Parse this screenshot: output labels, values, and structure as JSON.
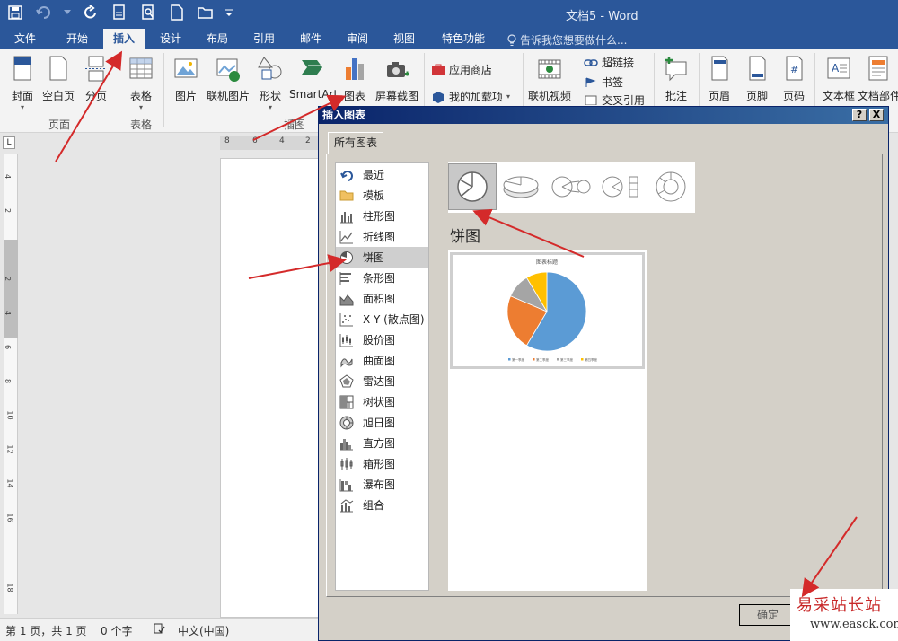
{
  "window": {
    "title": "文档5 - Word"
  },
  "tabs": [
    "文件",
    "开始",
    "插入",
    "设计",
    "布局",
    "引用",
    "邮件",
    "审阅",
    "视图",
    "特色功能"
  ],
  "active_tab": "插入",
  "tell_me": "告诉我您想要做什么...",
  "ribbon": {
    "pages_group": {
      "cover": "封面",
      "blank_page": "空白页",
      "page_break": "分页",
      "label": "页面"
    },
    "tables_group": {
      "table": "表格",
      "label": "表格"
    },
    "illustrations_group": {
      "picture": "图片",
      "online_picture": "联机图片",
      "shapes": "形状",
      "smartart": "SmartArt",
      "chart": "图表",
      "screenshot": "屏幕截图",
      "label": "插图"
    },
    "addins": {
      "store": "应用商店",
      "my_addins": "我的加载项"
    },
    "media": {
      "online_video": "联机视频"
    },
    "links": {
      "hyperlink": "超链接",
      "bookmark": "书签",
      "cross_reference": "交叉引用"
    },
    "comment": "批注",
    "header": "页眉",
    "footer": "页脚",
    "page_number": "页码",
    "text_box": "文本框",
    "doc_parts": "文档部件"
  },
  "ruler": {
    "h_ticks": [
      "8",
      "6",
      "4",
      "2"
    ],
    "v_ticks": [
      "4",
      "2",
      "2",
      "4",
      "6",
      "8",
      "10",
      "12",
      "14",
      "16",
      "18"
    ]
  },
  "statusbar": {
    "page": "第 1 页，共 1 页",
    "words": "0 个字",
    "language": "中文(中国)"
  },
  "dialog": {
    "title": "插入图表",
    "help": "?",
    "close": "X",
    "tab": "所有图表",
    "categories": [
      "最近",
      "模板",
      "柱形图",
      "折线图",
      "饼图",
      "条形图",
      "面积图",
      "X Y (散点图)",
      "股价图",
      "曲面图",
      "雷达图",
      "树状图",
      "旭日图",
      "直方图",
      "箱形图",
      "瀑布图",
      "组合"
    ],
    "selected_category": "饼图",
    "subtypes": [
      "pie",
      "3d-pie",
      "pie-of-pie",
      "bar-of-pie",
      "doughnut"
    ],
    "type_heading": "饼图",
    "ok": "确定"
  },
  "chart_data": {
    "type": "pie",
    "title": "图表标题",
    "categories": [
      "第一季度",
      "第二季度",
      "第三季度",
      "第四季度"
    ],
    "values": [
      8.2,
      3.2,
      1.4,
      1.2
    ],
    "colors": [
      "#5b9bd5",
      "#ed7d31",
      "#a5a5a5",
      "#ffc000"
    ]
  },
  "watermark": {
    "text": "易采站长站",
    "url": "www.easck.com"
  }
}
